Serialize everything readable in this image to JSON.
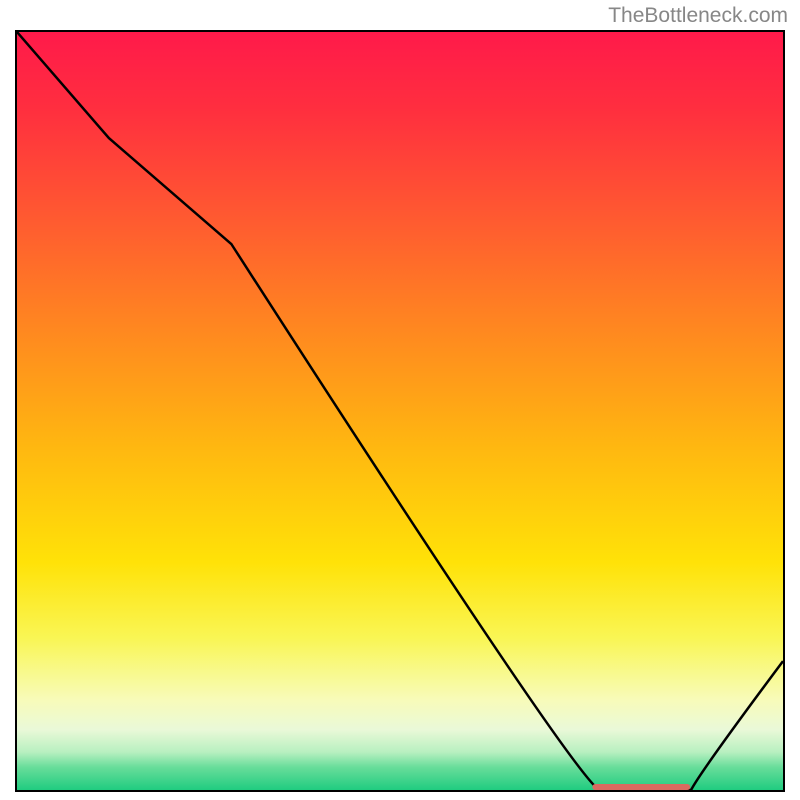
{
  "attribution": "TheBottleneck.com",
  "chart_data": {
    "type": "line",
    "title": "",
    "xlabel": "",
    "ylabel": "",
    "x": [
      0,
      0.12,
      0.28,
      0.76,
      0.84,
      0.88,
      1.0
    ],
    "y": [
      1.0,
      0.86,
      0.72,
      0.0,
      0.0,
      0.0,
      0.17
    ],
    "xlim": [
      0,
      1
    ],
    "ylim": [
      0,
      1
    ],
    "gradient_stops": [
      {
        "pos": 0.0,
        "color": "#ff1a4a"
      },
      {
        "pos": 0.1,
        "color": "#ff2e3f"
      },
      {
        "pos": 0.25,
        "color": "#ff5b30"
      },
      {
        "pos": 0.4,
        "color": "#ff8a1f"
      },
      {
        "pos": 0.55,
        "color": "#ffb810"
      },
      {
        "pos": 0.7,
        "color": "#ffe208"
      },
      {
        "pos": 0.8,
        "color": "#f9f655"
      },
      {
        "pos": 0.88,
        "color": "#f8fbb8"
      },
      {
        "pos": 0.92,
        "color": "#eaf9d8"
      },
      {
        "pos": 0.95,
        "color": "#b8f0c0"
      },
      {
        "pos": 0.97,
        "color": "#68dd9a"
      },
      {
        "pos": 1.0,
        "color": "#20cc80"
      }
    ],
    "marker": {
      "x_start": 0.755,
      "x_end": 0.875,
      "y": 0.0,
      "color": "#d96a60"
    }
  }
}
